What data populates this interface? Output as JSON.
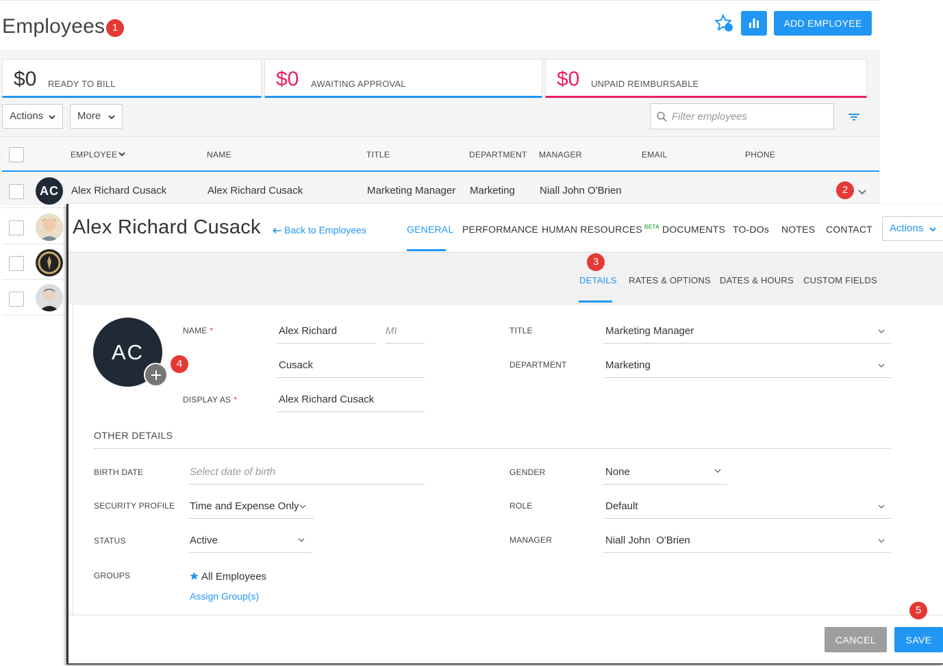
{
  "header": {
    "title": "Employees",
    "add_button": "ADD EMPLOYEE"
  },
  "badges": [
    "1",
    "2",
    "3",
    "4",
    "5"
  ],
  "stats": [
    {
      "amount": "$0",
      "label": "READY TO BILL",
      "color": "#333333"
    },
    {
      "amount": "$0",
      "label": "AWAITING APPROVAL",
      "color": "#e91e63"
    },
    {
      "amount": "$0",
      "label": "UNPAID REIMBURSABLE",
      "color": "#e91e63"
    }
  ],
  "toolbar": {
    "actions_label": "Actions",
    "more_label": "More",
    "filter_placeholder": "Filter employees"
  },
  "table": {
    "columns": [
      "EMPLOYEE",
      "NAME",
      "TITLE",
      "DEPARTMENT",
      "MANAGER",
      "EMAIL",
      "PHONE"
    ],
    "rows": [
      {
        "initials": "AC",
        "employee": "Alex Richard Cusack",
        "name": "Alex Richard Cusack",
        "title": "Marketing Manager",
        "department": "Marketing",
        "manager": "Niall John O'Brien",
        "email": "",
        "phone": ""
      }
    ]
  },
  "detail": {
    "employee_name": "Alex Richard Cusack",
    "back_link": "Back to Employees",
    "tabs": [
      "GENERAL",
      "PERFORMANCE",
      "HUMAN RESOURCES",
      "DOCUMENTS",
      "TO-DOs",
      "NOTES",
      "CONTACT"
    ],
    "beta_label": "BETA",
    "actions_label": "Actions",
    "subtabs": [
      "DETAILS",
      "RATES & OPTIONS",
      "DATES & HOURS",
      "CUSTOM FIELDS"
    ],
    "avatar_initials": "AC",
    "form": {
      "name_label": "NAME",
      "first_middle": "Alex Richard",
      "mi_placeholder": "MI",
      "last_name": "Cusack",
      "display_as_label": "DISPLAY AS",
      "display_as": "Alex Richard Cusack",
      "title_label": "TITLE",
      "title": "Marketing Manager",
      "department_label": "DEPARTMENT",
      "department": "Marketing"
    },
    "other_details": {
      "section_title": "OTHER DETAILS",
      "birth_date_label": "BIRTH DATE",
      "birth_date_placeholder": "Select date of birth",
      "security_profile_label": "SECURITY PROFILE",
      "security_profile": "Time and Expense Only",
      "status_label": "STATUS",
      "status": "Active",
      "groups_label": "GROUPS",
      "group": "All Employees",
      "assign_groups": "Assign Group(s)",
      "gender_label": "GENDER",
      "gender": "None",
      "role_label": "ROLE",
      "role": "Default",
      "manager_label": "MANAGER",
      "manager": "Niall John  O'Brien"
    },
    "footer": {
      "cancel": "CANCEL",
      "save": "SAVE"
    }
  },
  "colors": {
    "accent": "#2196f3",
    "alert": "#e91e63",
    "badge": "#e53935",
    "avatar": "#1f2a36"
  }
}
